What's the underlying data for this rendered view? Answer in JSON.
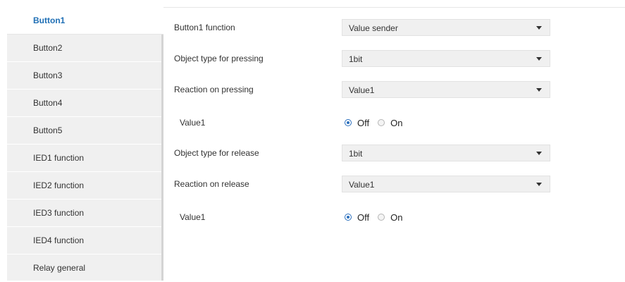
{
  "sidebar": {
    "items": [
      {
        "label": "Button1",
        "active": true
      },
      {
        "label": "Button2"
      },
      {
        "label": "Button3"
      },
      {
        "label": "Button4"
      },
      {
        "label": "Button5"
      },
      {
        "label": "IED1 function"
      },
      {
        "label": "IED2 function"
      },
      {
        "label": "IED3 function"
      },
      {
        "label": "IED4 function"
      },
      {
        "label": "Relay general"
      }
    ]
  },
  "form": {
    "button1_function": {
      "label": "Button1 function",
      "value": "Value sender"
    },
    "object_type_pressing": {
      "label": "Object type for pressing",
      "value": "1bit"
    },
    "reaction_pressing": {
      "label": "Reaction on pressing",
      "value": "Value1"
    },
    "value1_pressing": {
      "label": "Value1",
      "options": [
        "Off",
        "On"
      ],
      "selected": "Off"
    },
    "object_type_release": {
      "label": "Object type for release",
      "value": "1bit"
    },
    "reaction_release": {
      "label": "Reaction on release",
      "value": "Value1"
    },
    "value1_release": {
      "label": "Value1",
      "options": [
        "Off",
        "On"
      ],
      "selected": "Off"
    }
  },
  "colors": {
    "accent": "#1f6fb5",
    "sidebar_bg": "#f0f0f0",
    "select_bg": "#f0f0f0"
  }
}
